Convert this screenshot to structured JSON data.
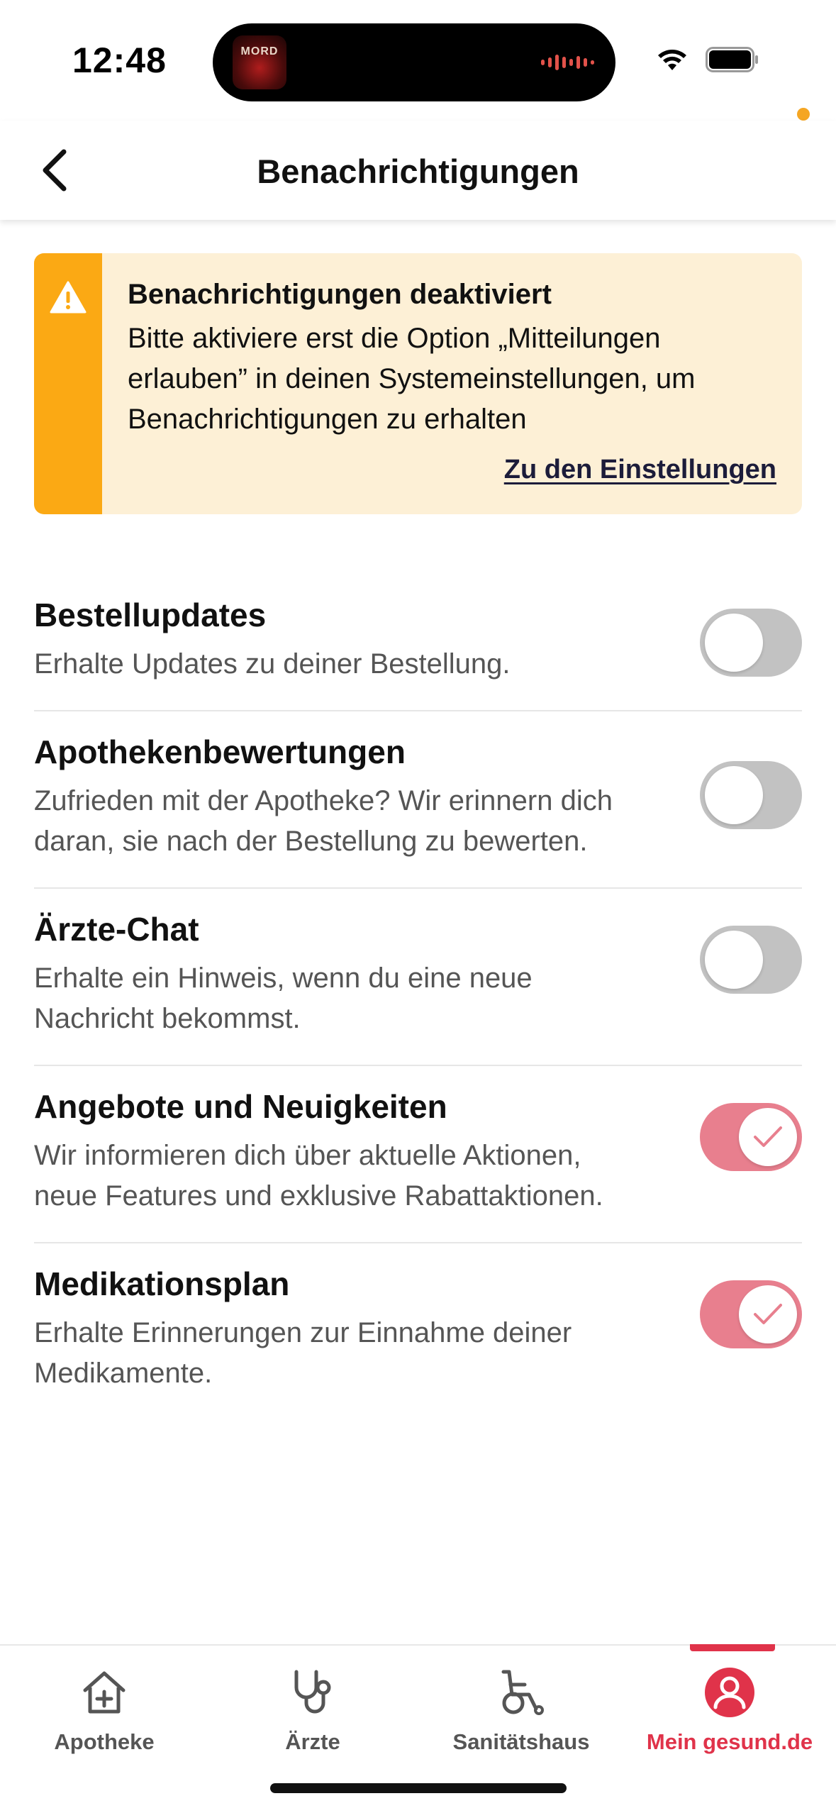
{
  "status_bar": {
    "time": "12:48",
    "now_playing_art_text": "MORD",
    "icons": [
      "wifi-icon",
      "battery-icon"
    ]
  },
  "header": {
    "title": "Benachrichtigungen",
    "back_icon": "chevron-left-icon"
  },
  "banner": {
    "title": "Benachrichtigungen deaktiviert",
    "text": "Bitte aktiviere erst die Option „Mitteilungen erlauben” in deinen Systemeinstellungen, um Benachrichtigungen zu erhalten",
    "link": "Zu den Einstellungen",
    "icon": "warning-icon",
    "accent_color": "#fba914",
    "background_color": "#fdf0d6"
  },
  "settings": [
    {
      "title": "Bestellupdates",
      "description": "Erhalte Updates zu deiner Bestellung.",
      "enabled": false
    },
    {
      "title": "Apothekenbewertungen",
      "description": "Zufrieden mit der Apotheke? Wir erinnern dich daran, sie nach der Bestellung zu bewerten.",
      "enabled": false
    },
    {
      "title": "Ärzte-Chat",
      "description": "Erhalte ein Hinweis, wenn du eine neue Nachricht bekommst.",
      "enabled": false
    },
    {
      "title": "Angebote und Neuigkeiten",
      "description": "Wir informieren dich über aktuelle Aktionen, neue Features und exklusive Rabattaktionen.",
      "enabled": true
    },
    {
      "title": "Medikationsplan",
      "description": "Erhalte Erinnerungen zur Einnahme deiner Medikamente.",
      "enabled": true
    }
  ],
  "tabs": [
    {
      "label": "Apotheke",
      "icon": "pharmacy-icon",
      "active": false
    },
    {
      "label": "Ärzte",
      "icon": "stethoscope-icon",
      "active": false
    },
    {
      "label": "Sanitätshaus",
      "icon": "wheelchair-icon",
      "active": false
    },
    {
      "label": "Mein gesund.de",
      "icon": "profile-icon",
      "active": true
    }
  ],
  "colors": {
    "brand": "#e0334a",
    "toggle_on": "#e87f8e",
    "toggle_off": "#c2c2c2"
  }
}
